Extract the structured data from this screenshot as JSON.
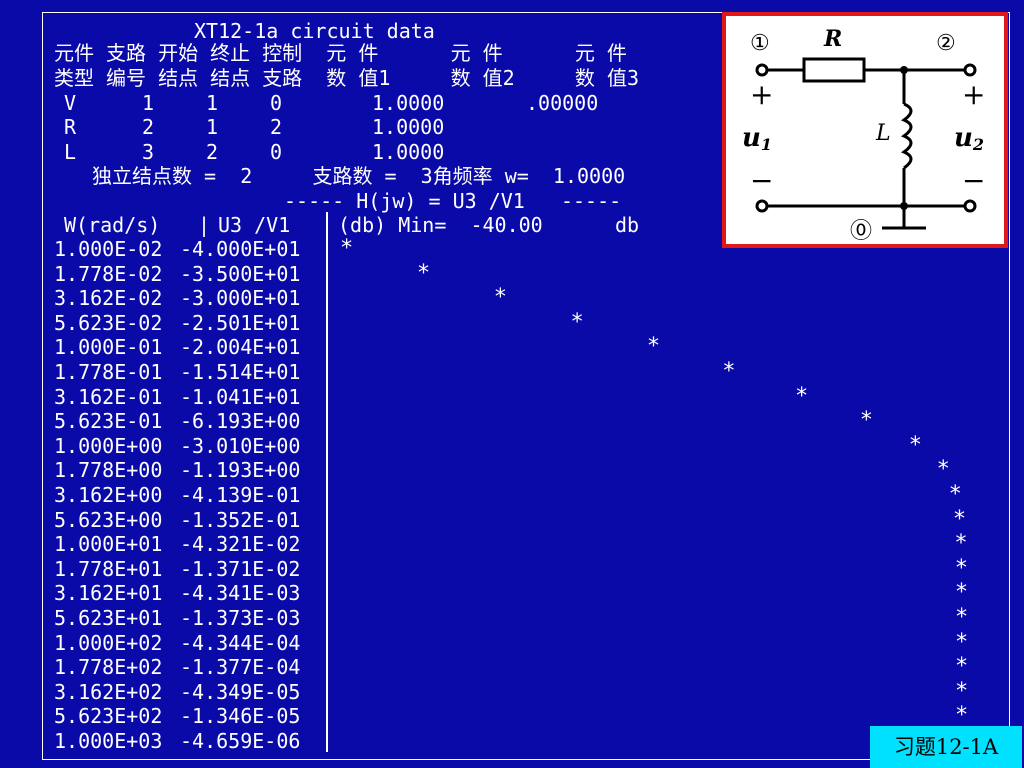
{
  "title": "XT12-1a circuit data",
  "header": {
    "row1": [
      "元件",
      "支路",
      "开始",
      "终止",
      "控制",
      "元 件",
      "元 件",
      "元 件"
    ],
    "row2": [
      "类型",
      "编号",
      "结点",
      "结点",
      "支路",
      "数 值1",
      "数 值2",
      "数 值3"
    ]
  },
  "elements": [
    {
      "type": "V",
      "branch": "1",
      "start": "1",
      "end": "0",
      "value1": "1.0000",
      "value2": ".00000"
    },
    {
      "type": "R",
      "branch": "2",
      "start": "1",
      "end": "2",
      "value1": "1.0000",
      "value2": ""
    },
    {
      "type": "L",
      "branch": "3",
      "start": "2",
      "end": "0",
      "value1": "1.0000",
      "value2": ""
    }
  ],
  "summary": {
    "nodes_label": "独立结点数 =",
    "nodes": "2",
    "branches_label": "支路数 =",
    "branches": "3",
    "freq_label": "角频率 w=",
    "freq": "1.0000"
  },
  "transfer": "----- H(jw) = U3 /V1   -----",
  "columns": {
    "w": "W(rad/s)",
    "h": "U3 /V1",
    "db": "(db) Min=  -40.00      db"
  },
  "rows": [
    {
      "w": "1.000E-02",
      "h": "-4.000E+01",
      "db": -40.0
    },
    {
      "w": "1.778E-02",
      "h": "-3.500E+01",
      "db": -35.0
    },
    {
      "w": "3.162E-02",
      "h": "-3.000E+01",
      "db": -30.0
    },
    {
      "w": "5.623E-02",
      "h": "-2.501E+01",
      "db": -25.01
    },
    {
      "w": "1.000E-01",
      "h": "-2.004E+01",
      "db": -20.04
    },
    {
      "w": "1.778E-01",
      "h": "-1.514E+01",
      "db": -15.14
    },
    {
      "w": "3.162E-01",
      "h": "-1.041E+01",
      "db": -10.41
    },
    {
      "w": "5.623E-01",
      "h": "-6.193E+00",
      "db": -6.193
    },
    {
      "w": "1.000E+00",
      "h": "-3.010E+00",
      "db": -3.01
    },
    {
      "w": "1.778E+00",
      "h": "-1.193E+00",
      "db": -1.193
    },
    {
      "w": "3.162E+00",
      "h": "-4.139E-01",
      "db": -0.4139
    },
    {
      "w": "5.623E+00",
      "h": "-1.352E-01",
      "db": -0.1352
    },
    {
      "w": "1.000E+01",
      "h": "-4.321E-02",
      "db": -0.04321
    },
    {
      "w": "1.778E+01",
      "h": "-1.371E-02",
      "db": -0.01371
    },
    {
      "w": "3.162E+01",
      "h": "-4.341E-03",
      "db": -0.004341
    },
    {
      "w": "5.623E+01",
      "h": "-1.373E-03",
      "db": -0.001373
    },
    {
      "w": "1.000E+02",
      "h": "-4.344E-04",
      "db": -0.0004344
    },
    {
      "w": "1.778E+02",
      "h": "-1.377E-04",
      "db": -0.0001377
    },
    {
      "w": "3.162E+02",
      "h": "-4.349E-05",
      "db": -4.349e-05
    },
    {
      "w": "5.623E+02",
      "h": "-1.346E-05",
      "db": -1.346e-05
    },
    {
      "w": "1.000E+03",
      "h": "-4.659E-06",
      "db": null
    }
  ],
  "plot": {
    "min_db": -40,
    "max_db": 0,
    "marker": "*"
  },
  "circuit": {
    "node1": "①",
    "node2": "②",
    "node0": "⓪",
    "R": "R",
    "L": "L",
    "u1": "u",
    "u1_sub": "1",
    "u2": "u",
    "u2_sub": "2",
    "plus": "+",
    "minus": "−"
  },
  "tag": "习题12-1A",
  "colors": {
    "background": "#0a0aa8",
    "text": "#ffffff",
    "circuit_border": "#e01818",
    "tag_bg": "#00e0ff"
  }
}
